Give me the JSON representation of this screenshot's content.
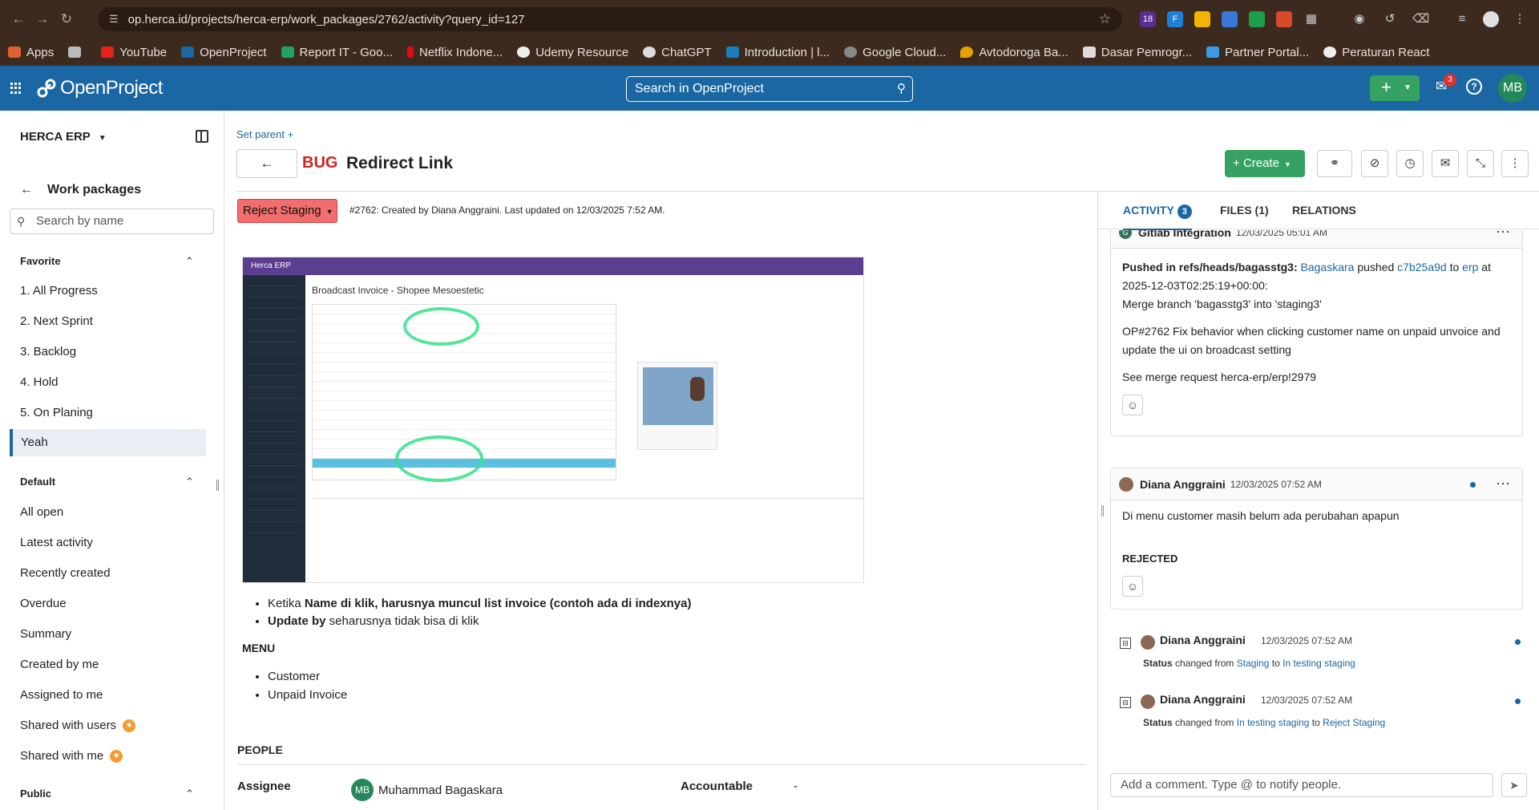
{
  "browser": {
    "url": "op.herca.id/projects/herca-erp/work_packages/2762/activity?query_id=127",
    "ext_badge": "18",
    "bookmarks": [
      "Apps",
      "YouTube",
      "OpenProject",
      "Report IT - Goo...",
      "Netflix Indone...",
      "Udemy Resource",
      "ChatGPT",
      "Introduction | l...",
      "Google Cloud...",
      "Avtodoroga Ba...",
      "Dasar Pemrogr...",
      "Partner Portal...",
      "Peraturan React"
    ]
  },
  "header": {
    "logo": "OpenProject",
    "search_placeholder": "Search in OpenProject",
    "notifications_count": "3",
    "user_initials": "MB"
  },
  "sidebar": {
    "project": "HERCA ERP",
    "back_label": "Work packages",
    "search_placeholder": "Search by name",
    "favorite_title": "Favorite",
    "favorite_items": [
      "1. All Progress",
      "2. Next Sprint",
      "3. Backlog",
      "4. Hold",
      "5. On Planing",
      "Yeah"
    ],
    "default_title": "Default",
    "default_items": [
      "All open",
      "Latest activity",
      "Recently created",
      "Overdue",
      "Summary",
      "Created by me",
      "Assigned to me",
      "Shared with users",
      "Shared with me"
    ],
    "public_title": "Public"
  },
  "wp": {
    "set_parent": "Set parent +",
    "type": "BUG",
    "title": "Redirect Link",
    "create_label": "Create",
    "status": "Reject Staging",
    "meta": "#2762: Created by Diana Anggraini. Last updated on 12/03/2025 7:52 AM.",
    "shot_app": "Herca ERP",
    "shot_title": "Broadcast Invoice - Shopee Mesoestetic",
    "bullet1_pre": "Ketika ",
    "bullet1_bold": "Name di klik, harusnya muncul list invoice (contoh ada di indexnya)",
    "bullet2_bold": "Update by",
    "bullet2_post": " seharusnya tidak bisa di klik",
    "menu_heading": "MENU",
    "menu_items": [
      "Customer",
      "Unpaid Invoice"
    ],
    "people_heading": "PEOPLE",
    "assignee_label": "Assignee",
    "assignee_initials": "MB",
    "assignee_name": "Muhammad Bagaskara",
    "accountable_label": "Accountable",
    "accountable_value": "-"
  },
  "activity": {
    "tab_activity": "ACTIVITY",
    "tab_activity_count": "3",
    "tab_files": "FILES (1)",
    "tab_relations": "RELATIONS",
    "gitlab_name": "Gitlab Integration",
    "gitlab_date": "12/03/2025 05:01 AM",
    "push_bold": "Pushed in refs/heads/bagasstg3:",
    "push_user": "Bagaskara",
    "push_word": "pushed",
    "push_commit": "c7b25a9d",
    "push_to": "to",
    "push_repo": "erp",
    "push_at": "at",
    "push_time": "2025-12-03T02:25:19+00:00:",
    "merge_line": "Merge branch 'bagasstg3' into 'staging3'",
    "fix_line": "OP#2762 Fix behavior when clicking customer name on unpaid unvoice and update the ui on broadcast setting",
    "see_line": "See merge request herca-erp/erp!2979",
    "diana_name": "Diana Anggraini",
    "diana_date": "12/03/2025 07:52 AM",
    "diana_comment": "Di menu customer masih belum ada perubahan apapun",
    "rejected": "REJECTED",
    "change1_date": "12/03/2025 07:52 AM",
    "change1_label": "Status",
    "change1_text": " changed from ",
    "change1_from": "Staging",
    "change1_to_word": " to ",
    "change1_to": "In testing staging",
    "change2_date": "12/03/2025 07:52 AM",
    "change2_label": "Status",
    "change2_text": " changed from ",
    "change2_from": "In testing staging",
    "change2_to_word": " to ",
    "change2_to": "Reject Staging",
    "comment_placeholder": "Add a comment. Type @ to notify people."
  }
}
